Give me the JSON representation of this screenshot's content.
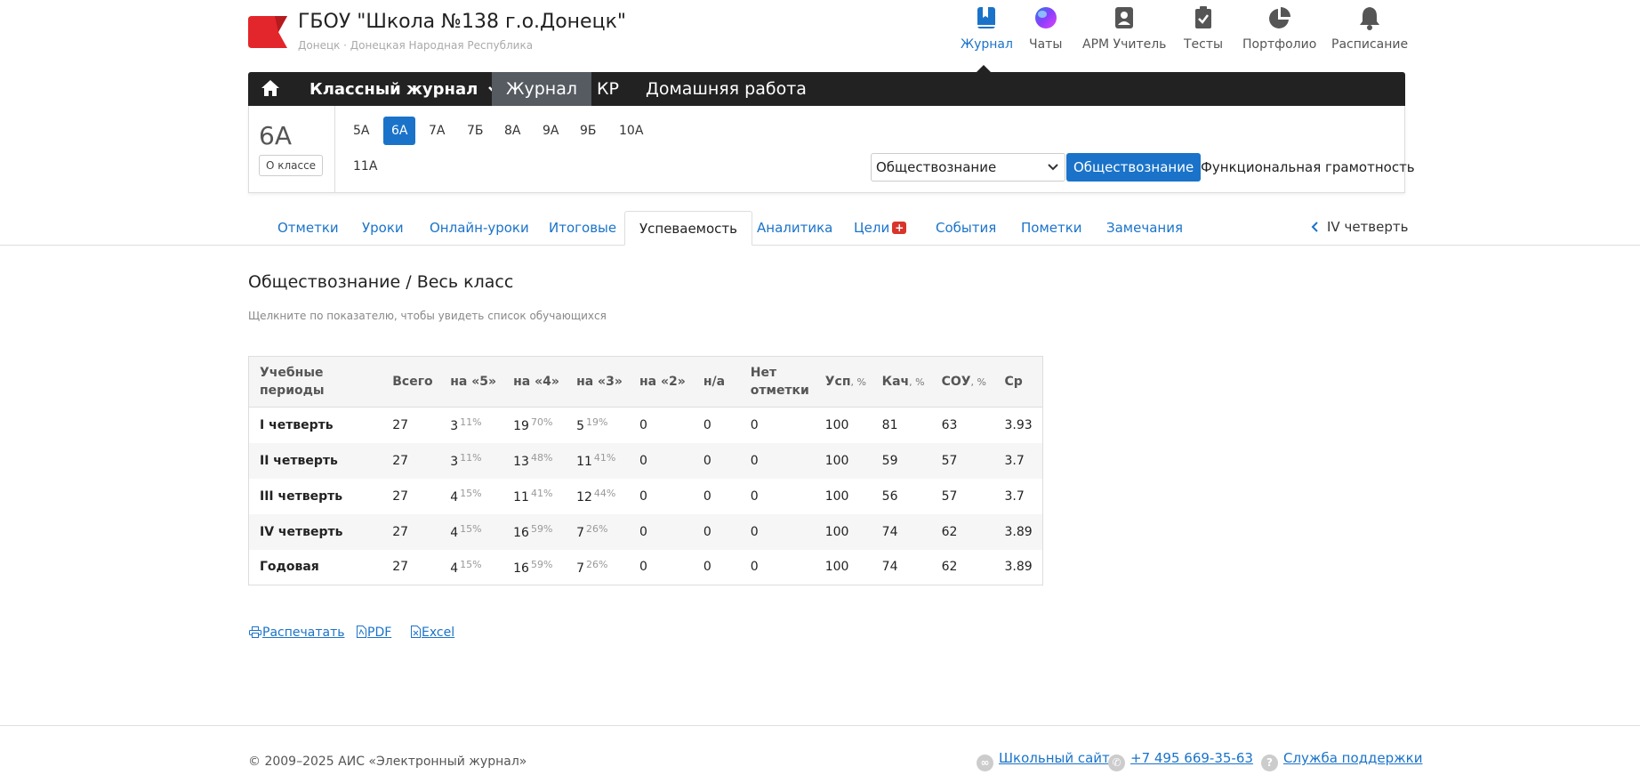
{
  "header": {
    "school_name": "ГБОУ \"Школа №138 г.о.Донецк\"",
    "school_location": "Донецк · Донецкая Народная Республика",
    "top_nav": [
      {
        "label": "Журнал",
        "icon": "book-icon",
        "active": true
      },
      {
        "label": "Чаты",
        "icon": "chat-orb-icon",
        "active": false
      },
      {
        "label": "АРМ Учитель",
        "icon": "teacher-badge-icon",
        "active": false
      },
      {
        "label": "Тесты",
        "icon": "clipboard-check-icon",
        "active": false
      },
      {
        "label": "Портфолио",
        "icon": "pie-chart-icon",
        "active": false
      },
      {
        "label": "Расписание",
        "icon": "bell-icon",
        "active": false
      }
    ]
  },
  "menubar": {
    "class_journal_label": "Классный журнал",
    "tabs": [
      {
        "label": "Журнал",
        "active": true
      },
      {
        "label": "КР",
        "active": false
      },
      {
        "label": "Домашняя работа",
        "active": false
      }
    ]
  },
  "class_panel": {
    "class_name": "6А",
    "about_label": "О классе",
    "classes": [
      "5А",
      "6А",
      "7А",
      "7Б",
      "8А",
      "9А",
      "9Б",
      "10А",
      "11А"
    ],
    "active_class": "6А",
    "subject_select_value": "Обществознание",
    "subject_button": "Обществознание",
    "functional_literacy": "Функциональная грамотность"
  },
  "subtabs": [
    {
      "label": "Отметки",
      "active": false
    },
    {
      "label": "Уроки",
      "active": false
    },
    {
      "label": "Онлайн-уроки",
      "active": false
    },
    {
      "label": "Итоговые",
      "active": false
    },
    {
      "label": "Успеваемость",
      "active": true
    },
    {
      "label": "Аналитика",
      "active": false
    },
    {
      "label": "Цели",
      "active": false,
      "badge": "+"
    },
    {
      "label": "События",
      "active": false
    },
    {
      "label": "Пометки",
      "active": false
    },
    {
      "label": "Замечания",
      "active": false
    }
  ],
  "quarter_selector": "IV четверть",
  "page_title": "Обществознание / Весь класс",
  "hint": "Щелкните по показателю, чтобы увидеть список обучающихся",
  "table": {
    "headers": {
      "period": "Учебные периоды",
      "total": "Всего",
      "g5": "на «5»",
      "g4": "на «4»",
      "g3": "на «3»",
      "g2": "на «2»",
      "na": "н/а",
      "none": "Нет отметки",
      "usp": "Усп",
      "kach": "Кач",
      "sou": "СОУ",
      "pct": ", %",
      "avg": "Ср"
    },
    "rows": [
      {
        "period": "I четверть",
        "total": "27",
        "g5": "3",
        "g5p": "11%",
        "g4": "19",
        "g4p": "70%",
        "g3": "5",
        "g3p": "19%",
        "g2": "0",
        "na": "0",
        "none": "0",
        "usp": "100",
        "kach": "81",
        "sou": "63",
        "avg": "3.93"
      },
      {
        "period": "II четверть",
        "total": "27",
        "g5": "3",
        "g5p": "11%",
        "g4": "13",
        "g4p": "48%",
        "g3": "11",
        "g3p": "41%",
        "g2": "0",
        "na": "0",
        "none": "0",
        "usp": "100",
        "kach": "59",
        "sou": "57",
        "avg": "3.7"
      },
      {
        "period": "III четверть",
        "total": "27",
        "g5": "4",
        "g5p": "15%",
        "g4": "11",
        "g4p": "41%",
        "g3": "12",
        "g3p": "44%",
        "g2": "0",
        "na": "0",
        "none": "0",
        "usp": "100",
        "kach": "56",
        "sou": "57",
        "avg": "3.7"
      },
      {
        "period": "IV четверть",
        "total": "27",
        "g5": "4",
        "g5p": "15%",
        "g4": "16",
        "g4p": "59%",
        "g3": "7",
        "g3p": "26%",
        "g2": "0",
        "na": "0",
        "none": "0",
        "usp": "100",
        "kach": "74",
        "sou": "62",
        "avg": "3.89"
      },
      {
        "period": "Годовая",
        "total": "27",
        "g5": "4",
        "g5p": "15%",
        "g4": "16",
        "g4p": "59%",
        "g3": "7",
        "g3p": "26%",
        "g2": "0",
        "na": "0",
        "none": "0",
        "usp": "100",
        "kach": "74",
        "sou": "62",
        "avg": "3.89"
      }
    ]
  },
  "export": {
    "print": "Распечатать",
    "pdf": "PDF",
    "excel": "Excel"
  },
  "footer": {
    "copyright": "© 2009–2025 АИС «Электронный журнал»",
    "school_site": "Школьный сайт",
    "phone": "+7 495 669-35-63",
    "support": "Служба поддержки"
  },
  "colors": {
    "accent": "#1a73c9",
    "dark_bar": "#222222",
    "badge_red": "#d9342b"
  }
}
